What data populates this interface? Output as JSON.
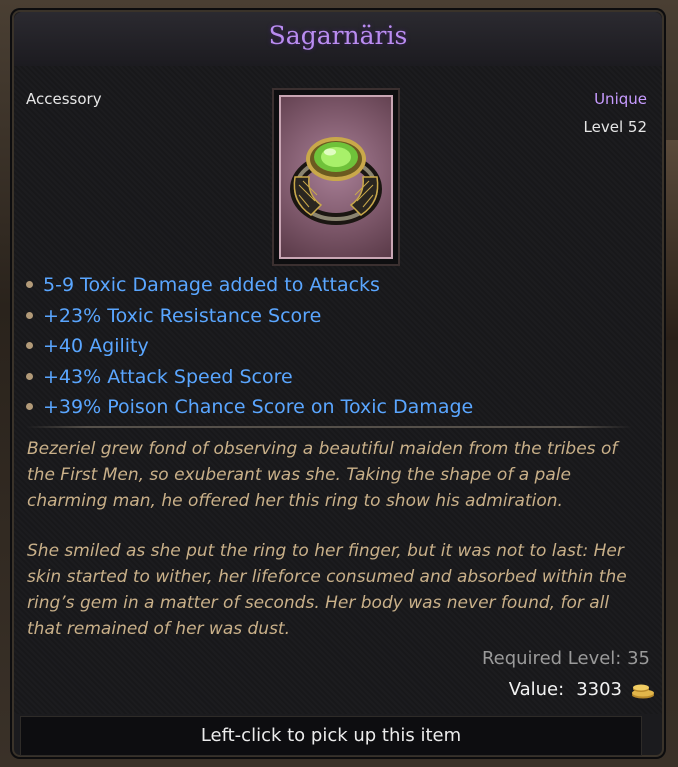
{
  "tooltip": {
    "title": "Sagarnäris",
    "item_type": "Accessory",
    "rarity": "Unique",
    "level": "Level 52",
    "icon": "emerald-ring-icon",
    "mods": [
      "5-9 Toxic Damage added to Attacks",
      "+23% Toxic Resistance Score",
      "+40 Agility",
      "+43% Attack Speed Score",
      "+39% Poison Chance Score on Toxic Damage"
    ],
    "lore": [
      "Bezeriel grew fond of observing a beautiful maiden from the tribes of the First Men, so exuberant was she. Taking the shape of a pale charming man, he offered her this ring to show his admiration.",
      "She smiled as she put the ring to her finger, but it was not to last: Her skin started to wither, her lifeforce consumed and absorbed within the ring’s gem in a matter of seconds. Her body was never found, for all that remained of her was dust."
    ],
    "required_level": "Required Level: 35",
    "value_label": "Value:",
    "value": "3303",
    "footer_hint": "Left-click to pick up this item"
  },
  "colors": {
    "title": "#b98cf0",
    "rarity": "#c79bff",
    "mod_text": "#5aa6ff",
    "lore_text": "#c9b089"
  }
}
